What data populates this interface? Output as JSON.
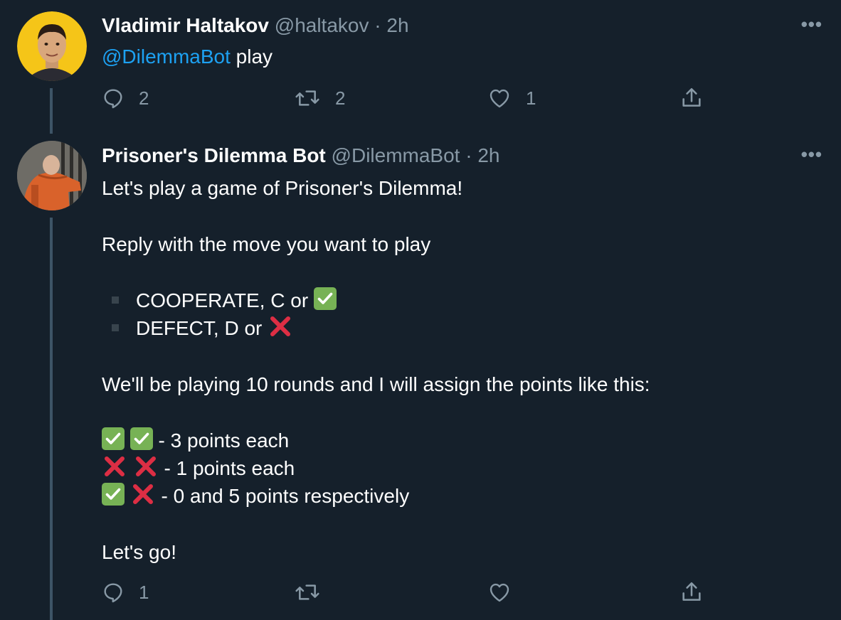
{
  "tweets": [
    {
      "name": "Vladimir Haltakov",
      "handle": "@haltakov",
      "separator": "·",
      "time": "2h",
      "mention": "@DilemmaBot",
      "text": " play",
      "reply_count": "2",
      "retweet_count": "2",
      "like_count": "1"
    },
    {
      "name": "Prisoner's Dilemma Bot",
      "handle": "@DilemmaBot",
      "separator": "·",
      "time": "2h",
      "line1": "Let's play a game of Prisoner's Dilemma!",
      "line2": "Reply with the move you want to play",
      "bullet1": "COOPERATE, C or ",
      "bullet2": "DEFECT, D or ",
      "line3": "We'll be playing 10 rounds and I will assign the points like this:",
      "score1": " - 3 points each",
      "score2": " - 1 points each",
      "score3": " - 0 and 5 points respectively",
      "line4": "Let's go!",
      "reply_count": "1",
      "retweet_count": "",
      "like_count": ""
    }
  ],
  "icons": {
    "reply": "reply-icon",
    "retweet": "retweet-icon",
    "like": "heart-icon",
    "share": "share-icon",
    "more": "more-icon",
    "check": "check-mark-emoji",
    "cross": "cross-mark-emoji"
  },
  "colors": {
    "background": "#15202b",
    "secondary_text": "#8899a6",
    "link": "#1da1f2",
    "check_green": "#77b255",
    "cross_red": "#dd2e44"
  },
  "more_glyph": "•••"
}
